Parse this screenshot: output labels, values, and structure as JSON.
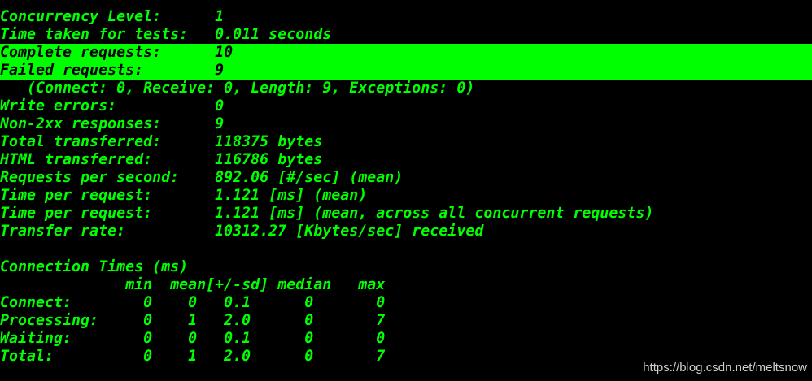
{
  "colors": {
    "background": "#000000",
    "text": "#00ff00",
    "highlight_background": "#00ff00",
    "highlight_text": "#000000",
    "watermark": "#d0d0d0"
  },
  "stats": {
    "concurrency_level": "Concurrency Level:      1",
    "time_taken": "Time taken for tests:   0.011 seconds",
    "complete_requests": "Complete requests:      10",
    "failed_requests": "Failed requests:        9",
    "failed_breakdown": "   (Connect: 0, Receive: 0, Length: 9, Exceptions: 0)",
    "write_errors": "Write errors:           0",
    "non_2xx": "Non-2xx responses:      9",
    "total_transferred": "Total transferred:      118375 bytes",
    "html_transferred": "HTML transferred:       116786 bytes",
    "requests_per_second": "Requests per second:    892.06 [#/sec] (mean)",
    "time_per_request_mean": "Time per request:       1.121 [ms] (mean)",
    "time_per_request_concurrent": "Time per request:       1.121 [ms] (mean, across all concurrent requests)",
    "transfer_rate": "Transfer rate:          10312.27 [Kbytes/sec] received"
  },
  "connection_times": {
    "title": "Connection Times (ms)",
    "header": "              min  mean[+/-sd] median   max",
    "rows": [
      "Connect:        0    0   0.1      0       0",
      "Processing:     0    1   2.0      0       7",
      "Waiting:        0    0   0.1      0       0",
      "Total:          0    1   2.0      0       7"
    ]
  },
  "watermark": "https://blog.csdn.net/meltsnow"
}
